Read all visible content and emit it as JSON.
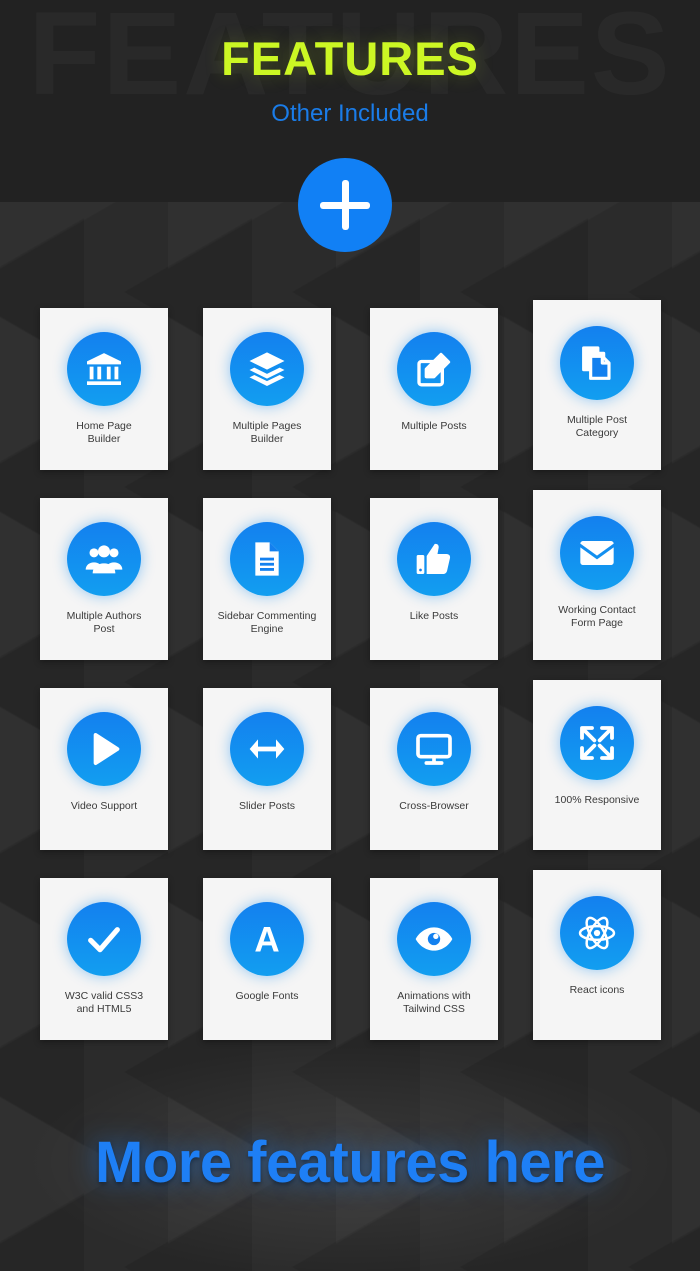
{
  "header": {
    "ghost_title": "FEATURES",
    "title": "FEATURES",
    "subtitle": "Other Included",
    "add_button_label": "+",
    "add_button_icon": "plus-icon"
  },
  "colors": {
    "title": "#ccf724",
    "subtitle": "#1a7ce8",
    "accent_blue": "#1180f5",
    "icon_gradient_top": "#1380ef",
    "icon_gradient_bottom": "#129ef0",
    "card_bg": "#f5f5f5",
    "card_label": "#3a3a3a",
    "page_bg": "#2b2b2b",
    "header_bg": "#222222",
    "footer_text": "#1e7ff5"
  },
  "features": [
    {
      "label": "Home Page\nBuilder",
      "icon": "bank-icon"
    },
    {
      "label": "Multiple Pages\nBuilder",
      "icon": "layers-icon"
    },
    {
      "label": "Multiple Posts",
      "icon": "edit-square-icon"
    },
    {
      "label": "Multiple Post\nCategory",
      "icon": "copy-documents-icon"
    },
    {
      "label": "Multiple Authors\nPost",
      "icon": "users-group-icon"
    },
    {
      "label": "Sidebar Commenting\nEngine",
      "icon": "document-lines-icon"
    },
    {
      "label": "Like Posts",
      "icon": "thumbs-up-icon"
    },
    {
      "label": "Working Contact\nForm Page",
      "icon": "envelope-icon"
    },
    {
      "label": "Video Support",
      "icon": "play-icon"
    },
    {
      "label": "Slider Posts",
      "icon": "arrows-horizontal-icon"
    },
    {
      "label": "Cross-Browser",
      "icon": "monitor-icon"
    },
    {
      "label": "100% Responsive",
      "icon": "expand-arrows-icon"
    },
    {
      "label": "W3C valid CSS3\nand HTML5",
      "icon": "check-icon"
    },
    {
      "label": "Google Fonts",
      "icon": "letter-a-icon"
    },
    {
      "label": "Animations with\nTailwind CSS",
      "icon": "eye-icon"
    },
    {
      "label": "React icons",
      "icon": "atom-icon"
    }
  ],
  "footer": {
    "text": "More features here"
  }
}
